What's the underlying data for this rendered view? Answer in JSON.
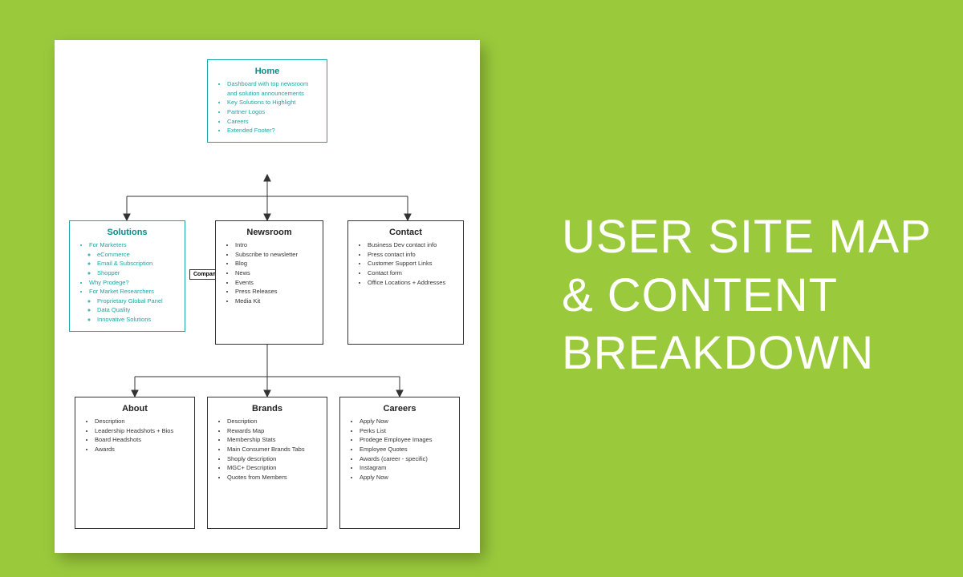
{
  "title": {
    "line1": "USER SITE MAP",
    "line2": "& CONTENT",
    "line3": "BREAKDOWN"
  },
  "companyLabel": "Company",
  "nodes": {
    "home": {
      "heading": "Home",
      "items": [
        "Dashboard with top newsroom and solution announcements",
        "Key Solutions to Highlight",
        "Partner Logos",
        "Careers",
        "Extended Footer?"
      ]
    },
    "solutions": {
      "heading": "Solutions",
      "items": [
        {
          "text": "For Marketers",
          "sub": [
            "eCommerce",
            "Email & Subscription",
            "Shopper"
          ]
        },
        {
          "text": "Why Prodege?"
        },
        {
          "text": "For Market Researchers",
          "sub": [
            "Proprietary Global Panel",
            "Data Quality",
            "Innovative Solutions"
          ]
        }
      ]
    },
    "newsroom": {
      "heading": "Newsroom",
      "items": [
        "Intro",
        "Subscribe to newsletter",
        "Blog",
        "News",
        "Events",
        "Press Releases",
        "Media Kit"
      ]
    },
    "contact": {
      "heading": "Contact",
      "items": [
        "Business Dev contact info",
        "Press contact info",
        "Customer Support Links",
        "Contact form",
        "Office Locations + Addresses"
      ]
    },
    "about": {
      "heading": "About",
      "items": [
        "Description",
        "Leadership Headshots + Bios",
        "Board Headshots",
        "Awards"
      ]
    },
    "brands": {
      "heading": "Brands",
      "items": [
        "Description",
        "Rewards Map",
        "Membership Stats",
        "Main Consumer Brands Tabs",
        "Shoply description",
        "MGC+ Description",
        "Quotes from Members"
      ]
    },
    "careers": {
      "heading": "Careers",
      "items": [
        "Apply Now",
        "Perks List",
        "Prodege Employee Images",
        "Employee Quotes",
        "Awards (career - specific)",
        "Instagram",
        "Apply Now"
      ]
    }
  }
}
